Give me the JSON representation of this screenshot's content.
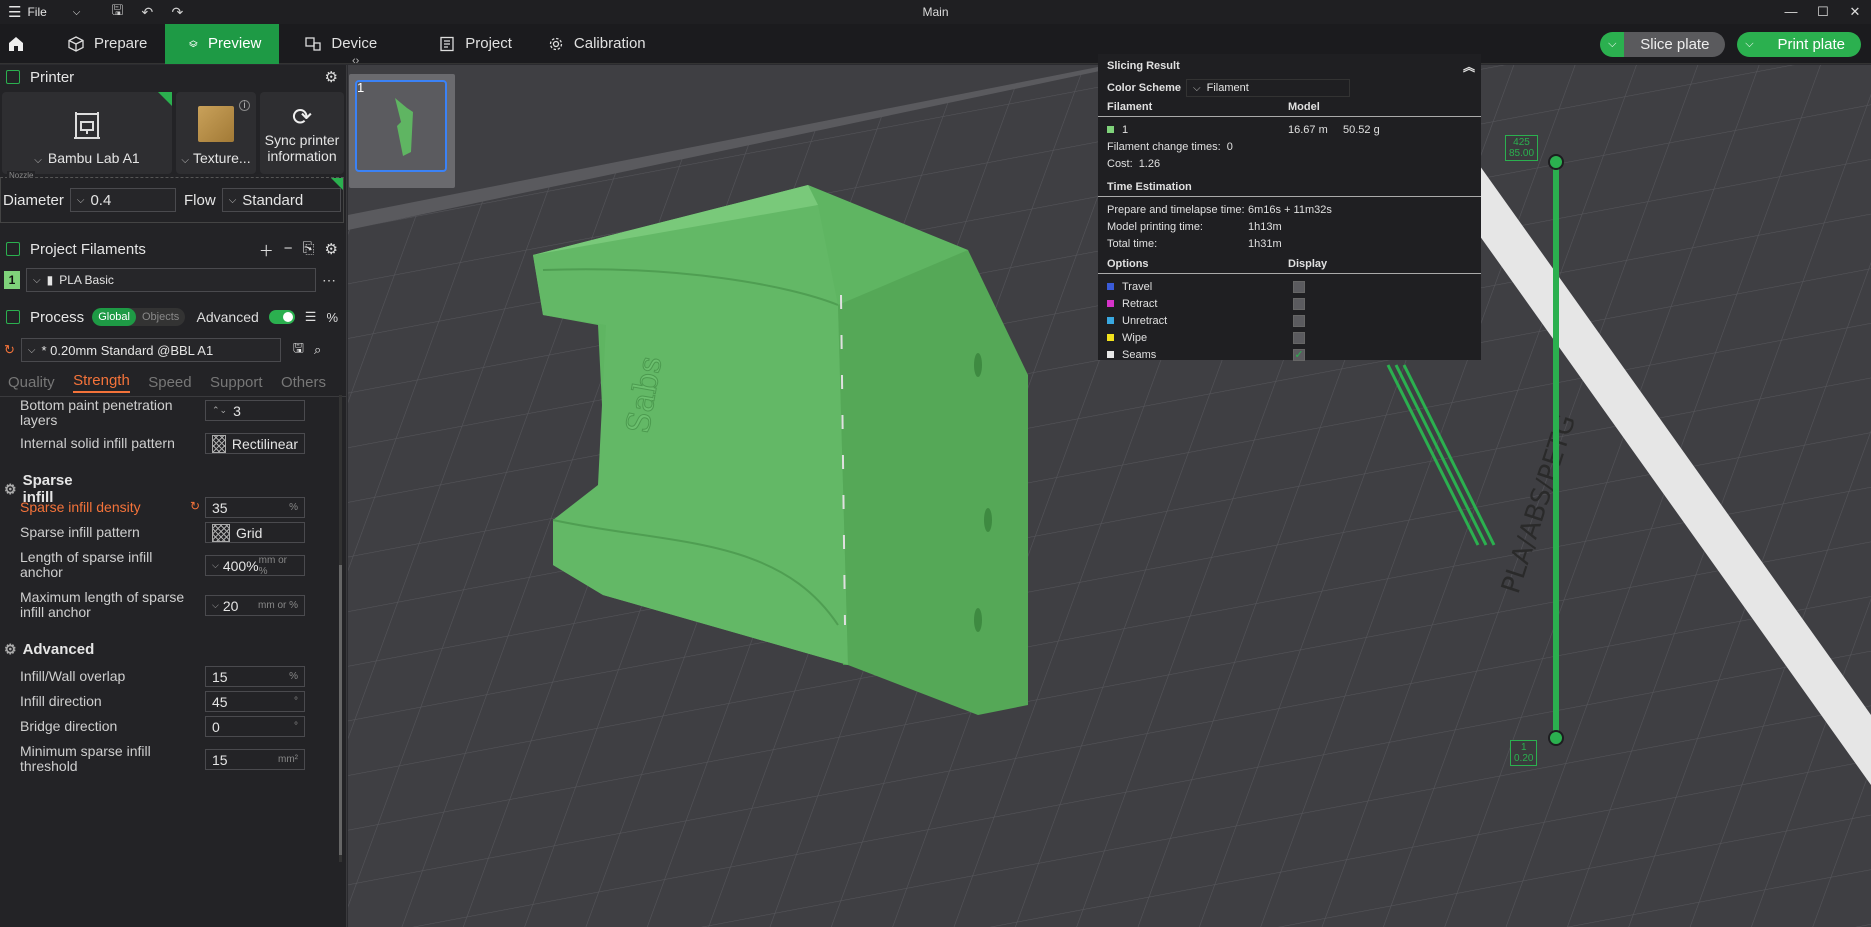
{
  "titlebar": {
    "file_label": "File",
    "window_title": "Main"
  },
  "nav": {
    "tabs": [
      {
        "label": "Prepare"
      },
      {
        "label": "Preview"
      },
      {
        "label": "Device"
      },
      {
        "label": "Project"
      },
      {
        "label": "Calibration"
      }
    ],
    "slice_label": "Slice plate",
    "print_label": "Print plate"
  },
  "printer": {
    "section_title": "Printer",
    "printer_name": "Bambu Lab A1",
    "plate_label": "Texture...",
    "sync_label_1": "Sync printer",
    "sync_label_2": "information",
    "nozzle_legend": "Nozzle",
    "diameter_label": "Diameter",
    "diameter_value": "0.4",
    "flow_label": "Flow",
    "flow_value": "Standard"
  },
  "filaments": {
    "section_title": "Project Filaments",
    "index": "1",
    "name": "PLA Basic"
  },
  "process": {
    "section_title": "Process",
    "global_label": "Global",
    "objects_label": "Objects",
    "advanced_label": "Advanced",
    "preset": "* 0.20mm Standard @BBL A1",
    "tabs": [
      "Quality",
      "Strength",
      "Speed",
      "Support",
      "Others"
    ],
    "settings": {
      "bottom_paint_label": "Bottom paint penetration layers",
      "bottom_paint_value": "3",
      "internal_solid_label": "Internal solid infill pattern",
      "internal_solid_value": "Rectilinear",
      "sparse_group": "Sparse infill",
      "density_label": "Sparse infill density",
      "density_value": "35",
      "density_unit": "%",
      "pattern_label": "Sparse infill pattern",
      "pattern_value": "Grid",
      "anchor_label": "Length of sparse infill anchor",
      "anchor_value": "400%",
      "anchor_unit": "mm or %",
      "max_anchor_label": "Maximum length of sparse infill anchor",
      "max_anchor_value": "20",
      "max_anchor_unit": "mm or %",
      "advanced_group": "Advanced",
      "overlap_label": "Infill/Wall overlap",
      "overlap_value": "15",
      "overlap_unit": "%",
      "direction_label": "Infill direction",
      "direction_value": "45",
      "direction_unit": "°",
      "bridge_label": "Bridge direction",
      "bridge_value": "0",
      "bridge_unit": "°",
      "min_sparse_label": "Minimum sparse infill threshold",
      "min_sparse_value": "15",
      "min_sparse_unit": "mm²"
    }
  },
  "plate_thumb": {
    "number": "1"
  },
  "slicing_result": {
    "title": "Slicing Result",
    "color_scheme_label": "Color Scheme",
    "color_scheme_value": "Filament",
    "filament_header": "Filament",
    "model_header": "Model",
    "filament_index": "1",
    "filament_length": "16.67 m",
    "filament_weight": "50.52 g",
    "change_times_label": "Filament change times:",
    "change_times_value": "0",
    "cost_label": "Cost:",
    "cost_value": "1.26",
    "time_header": "Time Estimation",
    "prepare_label": "Prepare and timelapse time:",
    "prepare_value": "6m16s + 11m32s",
    "model_time_label": "Model printing time:",
    "model_time_value": "1h13m",
    "total_label": "Total time:",
    "total_value": "1h31m",
    "options_header": "Options",
    "display_header": "Display",
    "options": [
      {
        "label": "Travel",
        "color": "#3a5bd9"
      },
      {
        "label": "Retract",
        "color": "#d633c9"
      },
      {
        "label": "Unretract",
        "color": "#39a8e0"
      },
      {
        "label": "Wipe",
        "color": "#f2e21d"
      },
      {
        "label": "Seams",
        "color": "#e6e6e6"
      }
    ]
  },
  "layer_slider": {
    "top_height": "425",
    "top_layer": "85.00",
    "bottom_height": "1",
    "bottom_layer": "0.20"
  },
  "bed_label": "PLA/ABS/PETG",
  "model_text": "Sabs",
  "colors": {
    "accent": "#2bb04f",
    "orange": "#f4733a",
    "model": "#5fb562"
  }
}
